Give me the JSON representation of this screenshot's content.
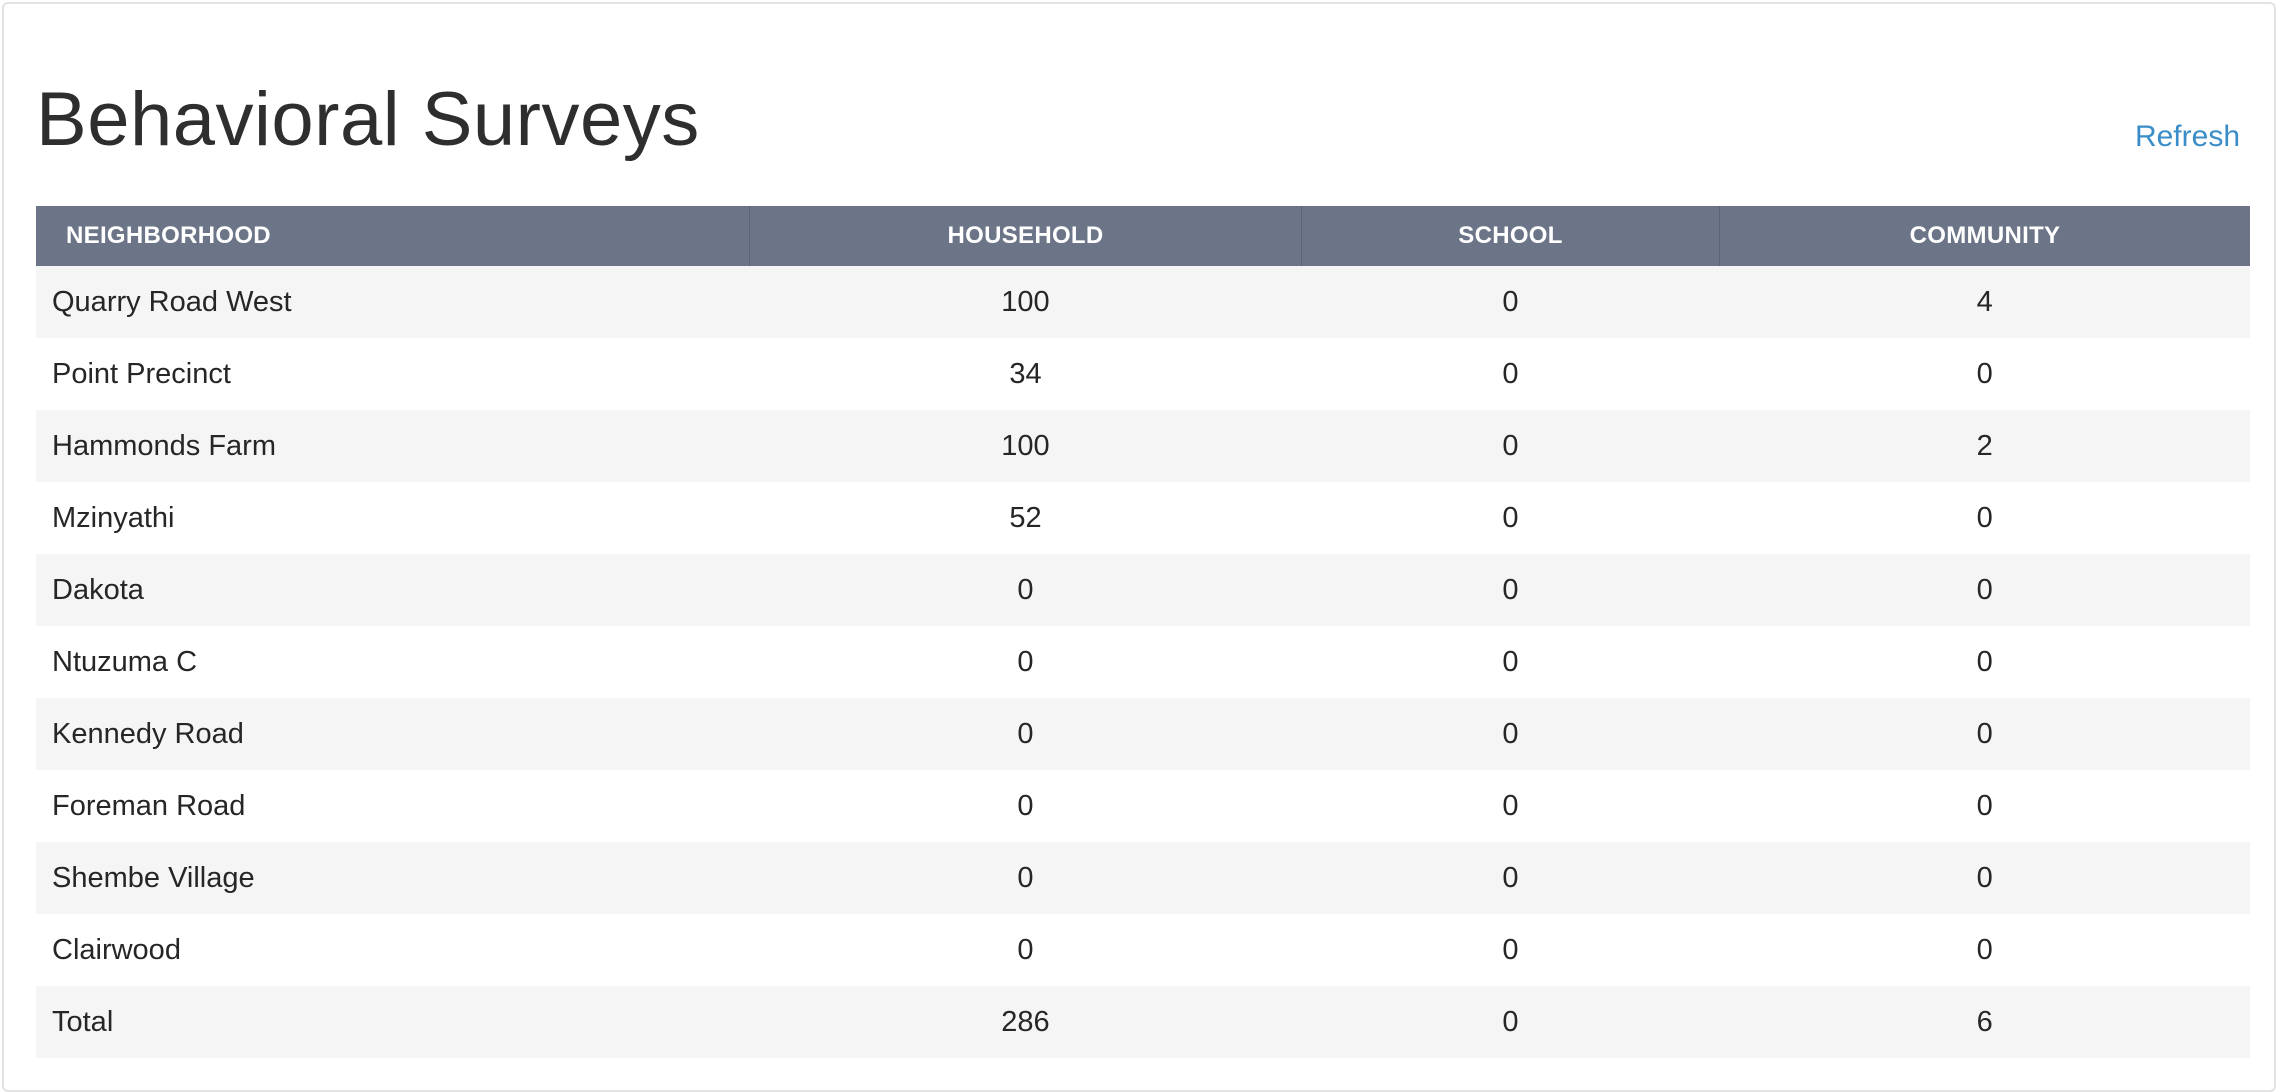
{
  "header": {
    "title": "Behavioral Surveys",
    "refresh_label": "Refresh"
  },
  "colors": {
    "header_bg": "#6b7587",
    "link": "#3a8dc8",
    "row_stripe": "#f5f5f5"
  },
  "table": {
    "columns": [
      "NEIGHBORHOOD",
      "HOUSEHOLD",
      "SCHOOL",
      "COMMUNITY"
    ],
    "rows": [
      {
        "neighborhood": "Quarry Road West",
        "household": "100",
        "school": "0",
        "community": "4"
      },
      {
        "neighborhood": "Point Precinct",
        "household": "34",
        "school": "0",
        "community": "0"
      },
      {
        "neighborhood": "Hammonds Farm",
        "household": "100",
        "school": "0",
        "community": "2"
      },
      {
        "neighborhood": "Mzinyathi",
        "household": "52",
        "school": "0",
        "community": "0"
      },
      {
        "neighborhood": "Dakota",
        "household": "0",
        "school": "0",
        "community": "0"
      },
      {
        "neighborhood": "Ntuzuma C",
        "household": "0",
        "school": "0",
        "community": "0"
      },
      {
        "neighborhood": "Kennedy Road",
        "household": "0",
        "school": "0",
        "community": "0"
      },
      {
        "neighborhood": "Foreman Road",
        "household": "0",
        "school": "0",
        "community": "0"
      },
      {
        "neighborhood": "Shembe Village",
        "household": "0",
        "school": "0",
        "community": "0"
      },
      {
        "neighborhood": "Clairwood",
        "household": "0",
        "school": "0",
        "community": "0"
      },
      {
        "neighborhood": "Total",
        "household": "286",
        "school": "0",
        "community": "6"
      }
    ]
  }
}
